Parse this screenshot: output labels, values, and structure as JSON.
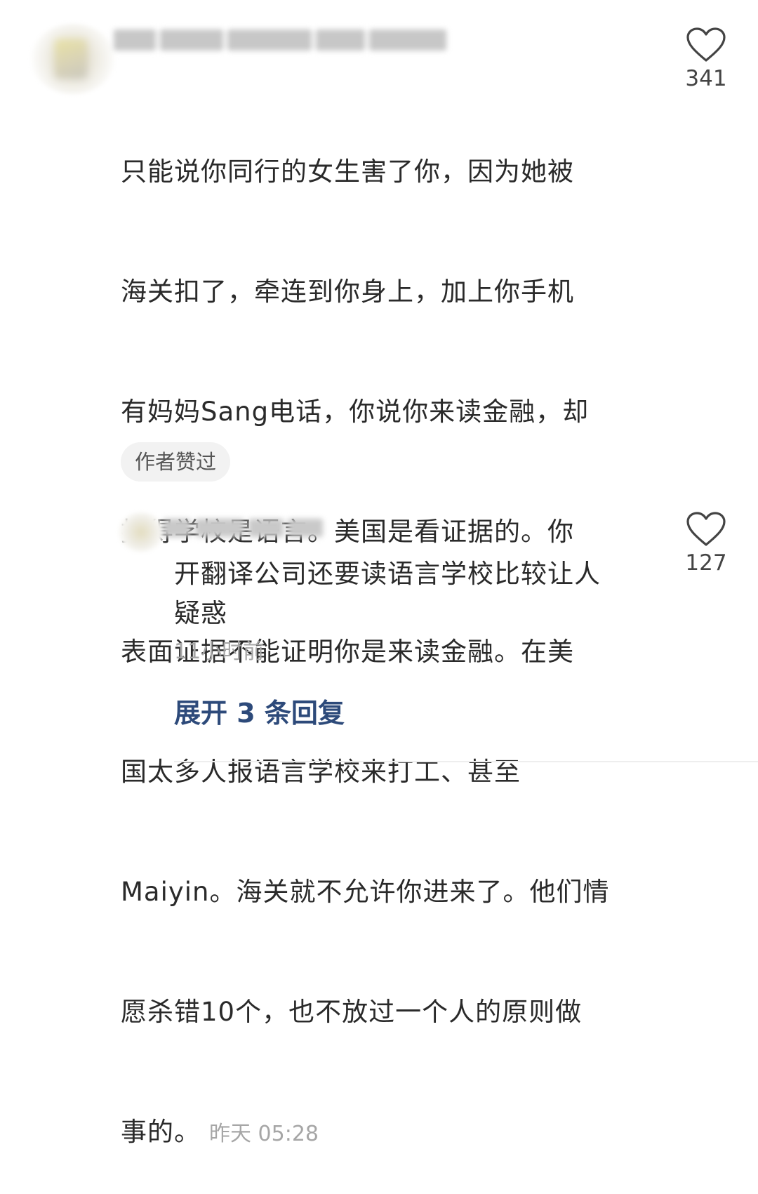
{
  "comment": {
    "lines": [
      "只能说你同行的女生害了你，因为她被",
      "海关扣了，牵连到你身上，加上你手机",
      "有妈妈Sang电话，你说你来读金融，却",
      "报得学校是语言。美国是看证据的。你",
      "表面证据不能证明你是来读金融。在美",
      "国太多人报语言学校来打工、甚至",
      "Maiyin。海关就不允许你进来了。他们情",
      "愿杀错10个，也不放过一个人的原则做",
      "事的。"
    ],
    "time": "昨天 05:28",
    "badge": "作者赞过",
    "like_count": "341",
    "like_icon": "heart-outline-icon"
  },
  "reply": {
    "lines": [
      "开翻译公司还要读语言学校比较让人",
      "疑惑"
    ],
    "time": "11小时前",
    "like_count": "127",
    "like_icon": "heart-outline-icon"
  },
  "expand_replies_label": "展开 3 条回复",
  "colors": {
    "text": "#2a2a2a",
    "meta": "#a6a6a6",
    "link": "#2d4a7a",
    "badge_bg": "#f2f2f2"
  }
}
